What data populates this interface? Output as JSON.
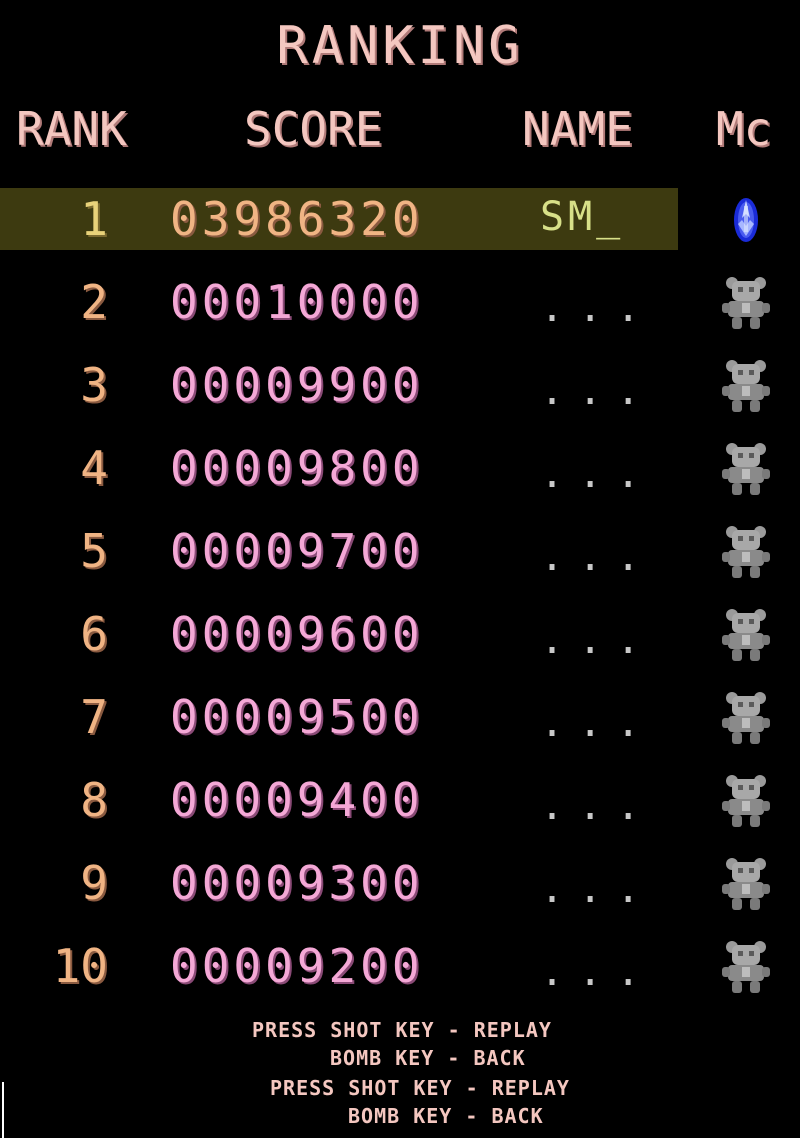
{
  "screen": {
    "title": "RANKING",
    "headers": {
      "rank": "RANK",
      "score": "SCORE",
      "name": "NAME",
      "mc": "Mc"
    },
    "rows": [
      {
        "rank": "1",
        "score": "03986320",
        "name": "SM_",
        "icon": "blue-ship-icon"
      },
      {
        "rank": "2",
        "score": "00010000",
        "name": "...",
        "icon": "gray-robot-icon"
      },
      {
        "rank": "3",
        "score": "00009900",
        "name": "...",
        "icon": "gray-robot-icon"
      },
      {
        "rank": "4",
        "score": "00009800",
        "name": "...",
        "icon": "gray-robot-icon"
      },
      {
        "rank": "5",
        "score": "00009700",
        "name": "...",
        "icon": "gray-robot-icon"
      },
      {
        "rank": "6",
        "score": "00009600",
        "name": "...",
        "icon": "gray-robot-icon"
      },
      {
        "rank": "7",
        "score": "00009500",
        "name": "...",
        "icon": "gray-robot-icon"
      },
      {
        "rank": "8",
        "score": "00009400",
        "name": "...",
        "icon": "gray-robot-icon"
      },
      {
        "rank": "9",
        "score": "00009300",
        "name": "...",
        "icon": "gray-robot-icon"
      },
      {
        "rank": "10",
        "score": "00009200",
        "name": "...",
        "icon": "gray-robot-icon"
      }
    ],
    "footer": [
      {
        "line1": "PRESS SHOT KEY - REPLAY",
        "line2": "BOMB KEY - BACK"
      },
      {
        "line1": "PRESS SHOT KEY - REPLAY",
        "line2": "BOMB KEY - BACK"
      }
    ],
    "colors": {
      "highlight": "#3d3a10",
      "score": "#f4a8d6",
      "rank": "#f0b484",
      "title": "#f4c7c0"
    }
  }
}
